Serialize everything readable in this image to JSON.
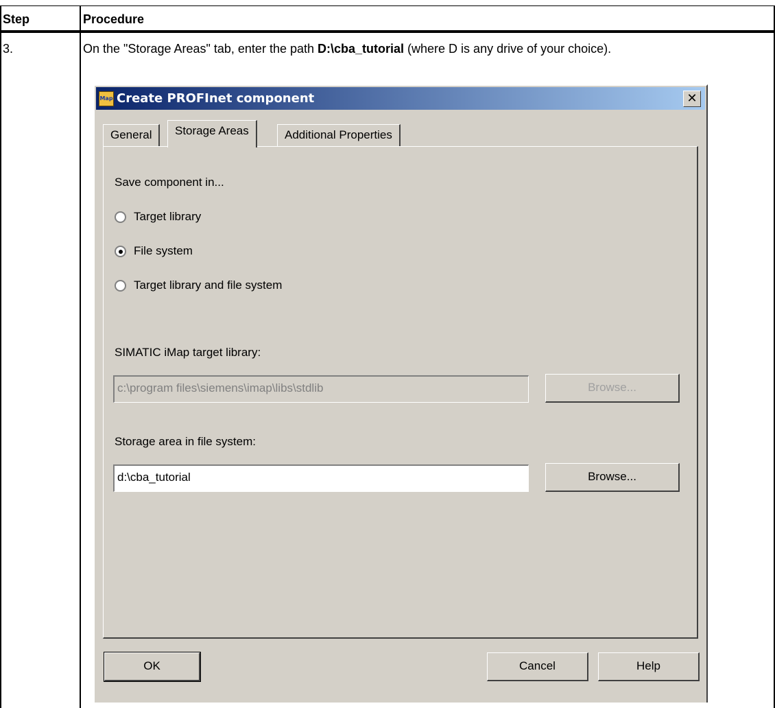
{
  "table": {
    "header": {
      "step": "Step",
      "procedure": "Procedure"
    },
    "row": {
      "step": "3.",
      "instruction_pre": "On the \"Storage Areas\" tab, enter the path ",
      "instruction_bold": "D:\\cba_tutorial",
      "instruction_post": " (where D is any drive of your choice)."
    }
  },
  "dialog": {
    "icon_text": "Map",
    "title": "Create PROFInet component",
    "close_label": "✕",
    "tabs": [
      {
        "label": "General",
        "active": false
      },
      {
        "label": "Storage Areas",
        "active": true
      },
      {
        "label": "Additional Properties",
        "active": false
      }
    ],
    "save_in_label": "Save component in...",
    "radios": [
      {
        "label": "Target library",
        "checked": false
      },
      {
        "label": "File system",
        "checked": true
      },
      {
        "label": "Target library and file system",
        "checked": false
      }
    ],
    "target_library_label": "SIMATIC iMap target library:",
    "target_library_value": "c:\\program files\\siemens\\imap\\libs\\stdlib",
    "browse_label": "Browse...",
    "storage_label": "Storage area in file system:",
    "storage_value": "d:\\cba_tutorial",
    "ok_label": "OK",
    "cancel_label": "Cancel",
    "help_label": "Help"
  }
}
